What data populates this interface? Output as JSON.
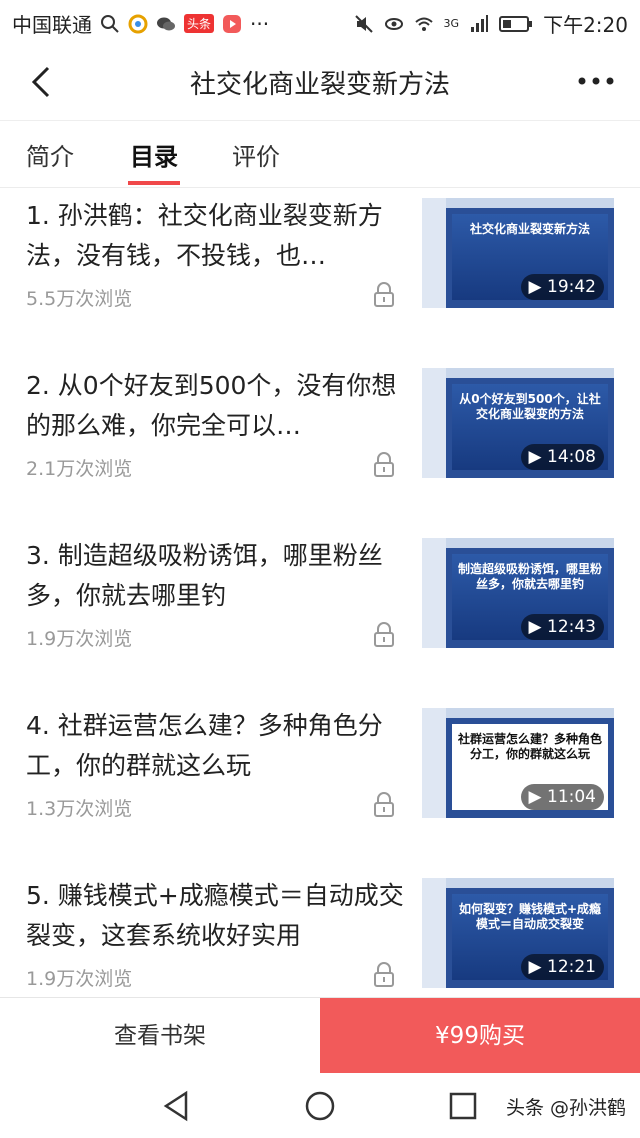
{
  "status_bar": {
    "carrier": "中国联通",
    "notif_badge": "头条",
    "network": "3G",
    "time": "下午2:20"
  },
  "header": {
    "title": "社交化商业裂变新方法"
  },
  "tabs": [
    {
      "label": "简介"
    },
    {
      "label": "目录"
    },
    {
      "label": "评价"
    }
  ],
  "lessons": [
    {
      "title": "1. 孙洪鹤：社交化商业裂变新方法，没有钱，不投钱，也…",
      "views": "5.5万次浏览",
      "duration": "19:42",
      "slide": "社交化商业裂变新方法"
    },
    {
      "title": "2. 从0个好友到500个，没有你想的那么难，你完全可以…",
      "views": "2.1万次浏览",
      "duration": "14:08",
      "slide": "从0个好友到500个，让社交化商业裂变的方法"
    },
    {
      "title": "3. 制造超级吸粉诱饵，哪里粉丝多，你就去哪里钓",
      "views": "1.9万次浏览",
      "duration": "12:43",
      "slide": "制造超级吸粉诱饵，哪里粉丝多，你就去哪里钓"
    },
    {
      "title": "4. 社群运营怎么建？多种角色分工，你的群就这么玩",
      "views": "1.3万次浏览",
      "duration": "11:04",
      "slide": "社群运营怎么建？多种角色分工，你的群就这么玩"
    },
    {
      "title": "5. 赚钱模式+成瘾模式＝自动成交裂变，这套系统收好实用",
      "views": "1.9万次浏览",
      "duration": "12:21",
      "slide": "如何裂变？赚钱模式+成瘾模式＝自动成交裂变"
    }
  ],
  "bottom": {
    "shelf_label": "查看书架",
    "buy_label": "¥99购买"
  },
  "watermark": "头条 @孙洪鹤",
  "colors": {
    "accent": "#f0484a",
    "buy_bg": "#f25a5a"
  }
}
